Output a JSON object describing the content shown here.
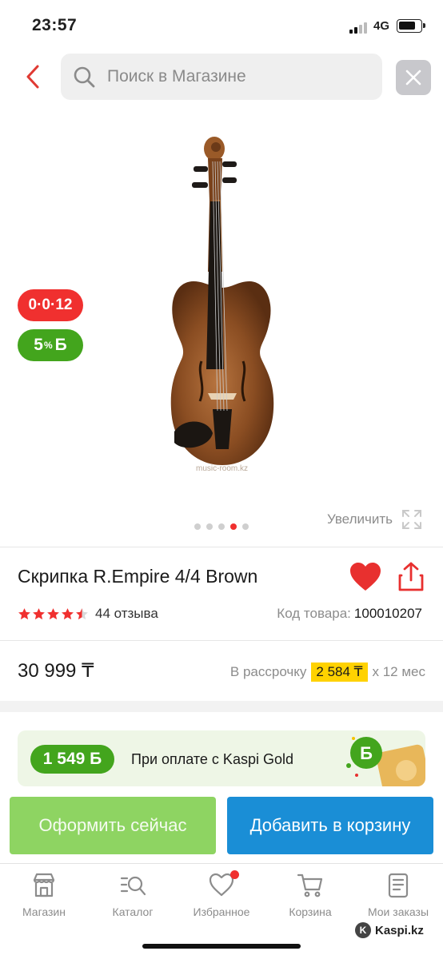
{
  "status_bar": {
    "time": "23:57",
    "network": "4G"
  },
  "search": {
    "placeholder": "Поиск в Магазине"
  },
  "gallery": {
    "watermark": "music-room.kz",
    "badges": {
      "installment": "0·0·12",
      "bonus_value": "5",
      "bonus_suffix": "%",
      "bonus_currency": "Б"
    },
    "zoom_label": "Увеличить",
    "slides_total": 5,
    "slide_active": 4
  },
  "product": {
    "title": "Скрипка R.Empire 4/4 Brown",
    "rating": 4.5,
    "reviews": "44 отзыва",
    "code_label": "Код товара:",
    "code_value": "100010207",
    "price": "30 999 ₸",
    "installment_prefix": "В рассрочку",
    "installment_amount": "2 584 ₸",
    "installment_suffix": "х 12 мес"
  },
  "kaspi_gold": {
    "bonus": "1 549 Б",
    "text": "При оплате с Kaspi Gold"
  },
  "actions": {
    "buy_now": "Оформить сейчас",
    "add_to_cart": "Добавить в корзину"
  },
  "tabs": [
    {
      "label": "Магазин",
      "icon": "store-icon"
    },
    {
      "label": "Каталог",
      "icon": "catalog-search-icon"
    },
    {
      "label": "Избранное",
      "icon": "heart-outline-icon"
    },
    {
      "label": "Корзина",
      "icon": "cart-icon"
    },
    {
      "label": "Мои заказы",
      "icon": "orders-icon"
    }
  ],
  "branding": {
    "kaspi_mark": "Kaspi.kz"
  },
  "colors": {
    "accent_red": "#f0302f",
    "green": "#43a51d",
    "blue": "#1a8ed6",
    "yellow": "#ffd200",
    "light_green": "#8ed462"
  }
}
